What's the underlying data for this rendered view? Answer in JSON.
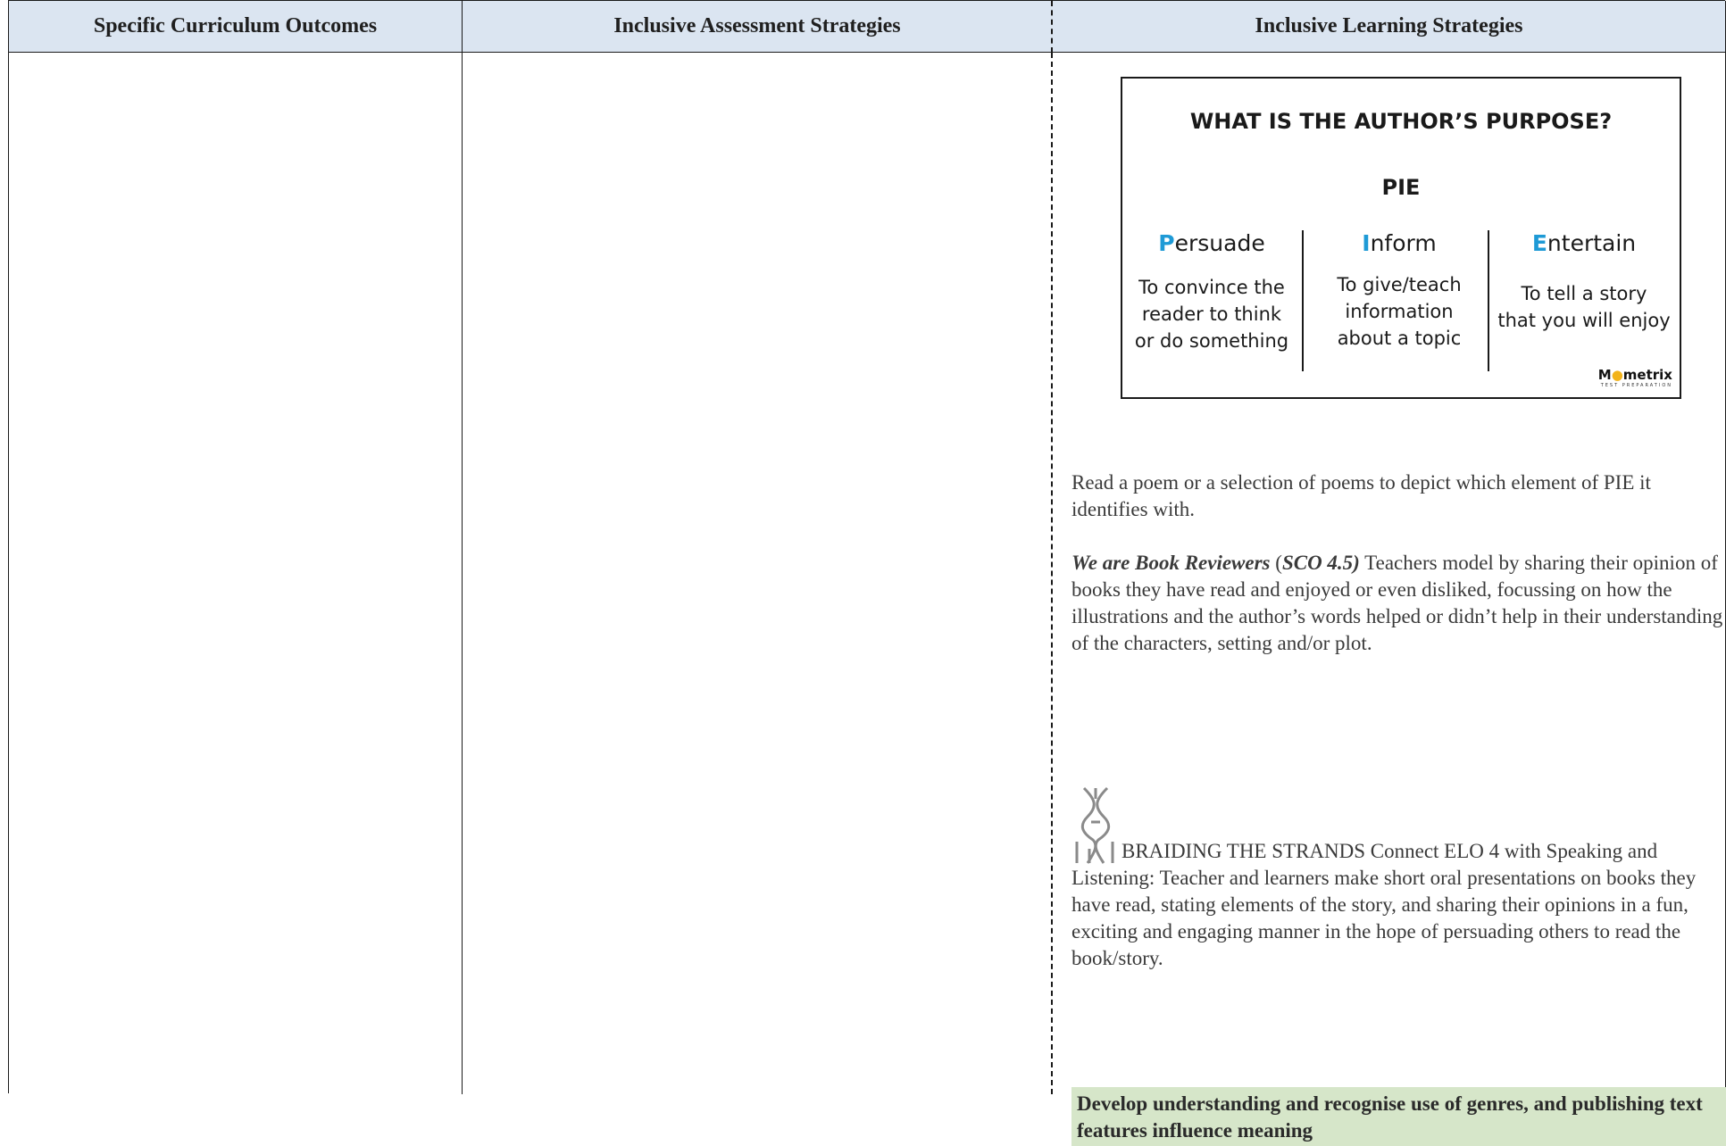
{
  "headers": {
    "col1": "Specific Curriculum Outcomes",
    "col2": "Inclusive Assessment Strategies",
    "col3": "Inclusive Learning Strategies"
  },
  "pie_graphic": {
    "title": "WHAT IS THE AUTHOR’S PURPOSE?",
    "subtitle": "PIE",
    "columns": [
      {
        "initial": "P",
        "rest": "ersuade",
        "desc": [
          "To convince the",
          "reader to think",
          "or do something"
        ]
      },
      {
        "initial": "I",
        "rest": "nform",
        "desc": [
          "To give/teach",
          "information",
          "about a topic"
        ]
      },
      {
        "initial": "E",
        "rest": "ntertain",
        "desc": [
          "To tell a story",
          "that you will enjoy"
        ]
      }
    ],
    "logo": {
      "brand_prefix": "M",
      "brand_suffix": "metrix",
      "tagline": "TEST PREPARATION"
    },
    "accent_color": "#1e9ad6"
  },
  "paragraphs": {
    "poem": "Read a poem or a selection of poems to depict which element of PIE it identifies with.",
    "reviewers_title": "We are Book Reviewers",
    "reviewers_sco": "SCO 4.5)",
    "reviewers_body": " Teachers model by sharing their opinion of books they have read and enjoyed or even disliked, focussing on  how the illustrations and the author’s words helped or didn’t help in their understanding of the characters, setting and/or plot.",
    "braiding": "BRAIDING THE STRANDS Connect ELO 4 with Speaking and Listening:  Teacher and learners make short oral presentations on books they have read, stating elements of the story, and sharing their opinions in a fun, exciting and engaging manner in the hope of persuading others to read the book/story."
  },
  "highlight": {
    "text": "Develop understanding and recognise use of genres, and publishing text features influence meaning",
    "color": "#d6e6c9"
  }
}
